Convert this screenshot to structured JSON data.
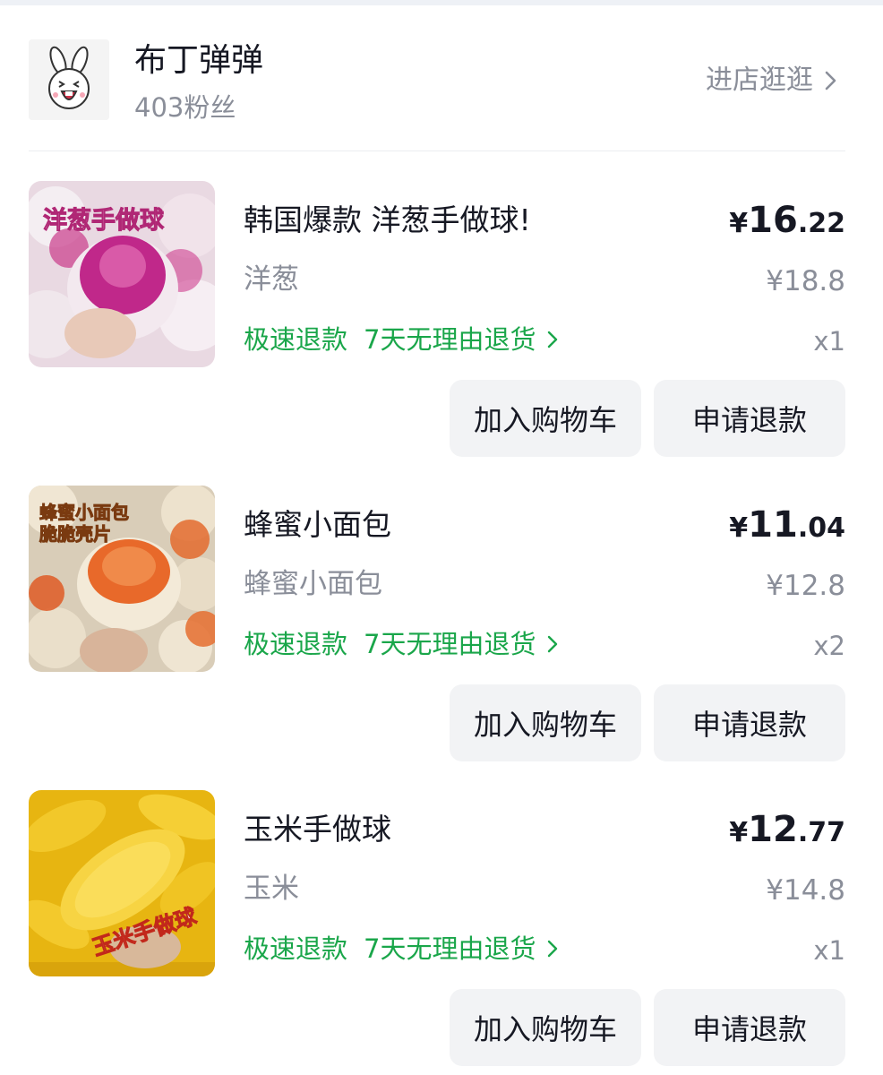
{
  "shop": {
    "name": "布丁弹弹",
    "fans": "403粉丝",
    "visit_label": "进店逛逛"
  },
  "products": [
    {
      "title": "韩国爆款 洋葱手做球!",
      "sku": "洋葱",
      "price_symbol": "¥",
      "price_int": "16",
      "price_dec": ".22",
      "original_price": "¥18.8",
      "tag_fast_refund": "极速退款",
      "tag_return": "7天无理由退货",
      "quantity": "x1",
      "cart_label": "加入购物车",
      "refund_label": "申请退款",
      "thumb_text": "洋葱手做球"
    },
    {
      "title": "蜂蜜小面包",
      "sku": "蜂蜜小面包",
      "price_symbol": "¥",
      "price_int": "11",
      "price_dec": ".04",
      "original_price": "¥12.8",
      "tag_fast_refund": "极速退款",
      "tag_return": "7天无理由退货",
      "quantity": "x2",
      "cart_label": "加入购物车",
      "refund_label": "申请退款",
      "thumb_text": "蜂蜜小面包 脆脆壳片"
    },
    {
      "title": "玉米手做球",
      "sku": "玉米",
      "price_symbol": "¥",
      "price_int": "12",
      "price_dec": ".77",
      "original_price": "¥14.8",
      "tag_fast_refund": "极速退款",
      "tag_return": "7天无理由退货",
      "quantity": "x1",
      "cart_label": "加入购物车",
      "refund_label": "申请退款",
      "thumb_text": "玉米手做球"
    }
  ],
  "colors": {
    "accent_green": "#1aa64a",
    "text_primary": "#161823",
    "text_secondary": "#8a8e99",
    "button_bg": "#f2f3f5"
  }
}
